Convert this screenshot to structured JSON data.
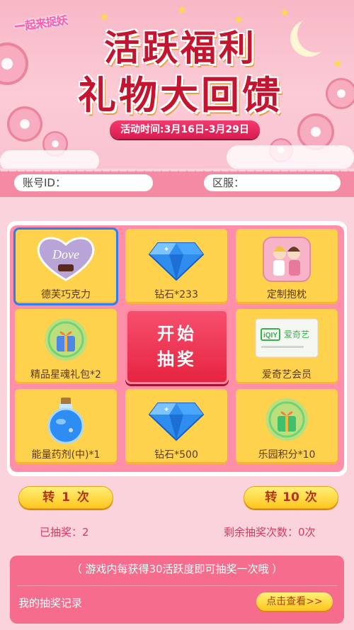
{
  "header": {
    "logo_text": "一起来捉妖",
    "title_line1": "活跃福利",
    "title_line2": "礼物大回馈",
    "date_banner": "活动时间:3月16日-3月29日"
  },
  "account": {
    "account_label": "账号ID：",
    "server_label": "区服："
  },
  "prizes": [
    {
      "label": "德芙巧克力",
      "icon": "chocolate-icon",
      "brand": "Dove",
      "selected": true
    },
    {
      "label": "钻石*233",
      "icon": "diamond-icon"
    },
    {
      "label": "定制抱枕",
      "icon": "pillow-icon"
    },
    {
      "label": "精品星魂礼包*2",
      "icon": "gift-orb-icon"
    },
    {
      "label": "爱奇艺会员",
      "icon": "iqiyi-card-icon",
      "brand": "爱奇艺"
    },
    {
      "label": "能量药剂(中)*1",
      "icon": "potion-icon"
    },
    {
      "label": "钻石*500",
      "icon": "diamond-icon"
    },
    {
      "label": "乐园积分*10",
      "icon": "points-orb-icon"
    }
  ],
  "start_button": {
    "line1": "开始",
    "line2": "抽奖"
  },
  "draw": {
    "once_prefix": "转",
    "once_count": "1",
    "once_suffix": "次",
    "ten_prefix": "转",
    "ten_count": "10",
    "ten_suffix": "次"
  },
  "stats": {
    "won_label": "已抽奖：2",
    "remaining_label": "剩余抽奖次数：0次"
  },
  "notice": "（ 游戏内每获得30活跃度即可抽奖一次哦 ）",
  "records": {
    "label": "我的抽奖记录",
    "view_button": "点击查看>>"
  },
  "colors": {
    "accent_pink": "#f56c8d",
    "cell_yellow": "#ffd24e",
    "start_red": "#e6233f",
    "title_red": "#c41530"
  }
}
